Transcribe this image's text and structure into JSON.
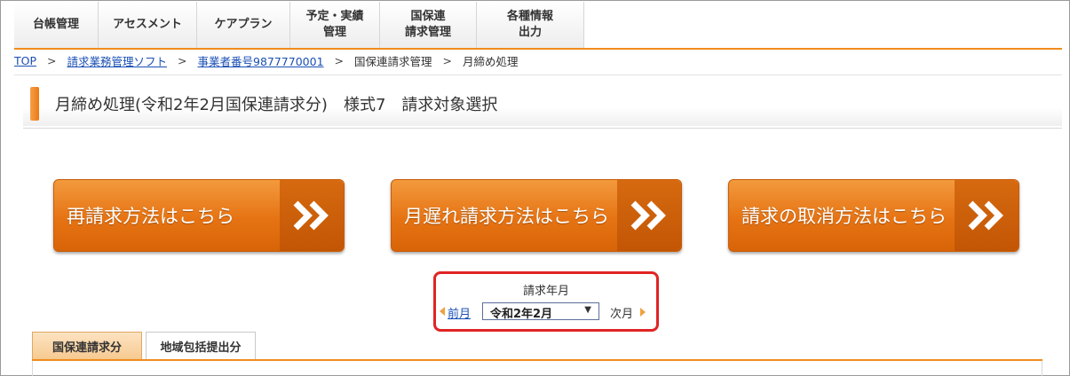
{
  "nav": {
    "items": [
      {
        "label": "台帳管理"
      },
      {
        "label": "アセスメント"
      },
      {
        "label": "ケアプラン"
      },
      {
        "label": "予定・実績\n管理"
      },
      {
        "label": "国保連\n請求管理"
      },
      {
        "label": "各種情報\n出力"
      }
    ]
  },
  "breadcrumb": {
    "top": "TOP",
    "software": "請求業務管理ソフト",
    "office": "事業者番号9877770001",
    "claim_mgmt": "国保連請求管理",
    "current": "月締め処理",
    "separator": ">"
  },
  "page": {
    "title": "月締め処理(令和2年2月国保連請求分)　様式7　請求対象選択"
  },
  "actions": {
    "rebill": "再請求方法はこちら",
    "late_bill": "月遅れ請求方法はこちら",
    "cancel_bill": "請求の取消方法はこちら"
  },
  "month_selector": {
    "title": "請求年月",
    "prev_label": "前月",
    "selected": "令和2年2月",
    "next_label": "次月",
    "highlight_color": "#e02424"
  },
  "tabs": [
    {
      "label": "国保連請求分",
      "active": true
    },
    {
      "label": "地域包括提出分",
      "active": false
    }
  ],
  "colors": {
    "accent": "#f08c1e",
    "button": "#e67313",
    "link": "#1a4fb5"
  }
}
